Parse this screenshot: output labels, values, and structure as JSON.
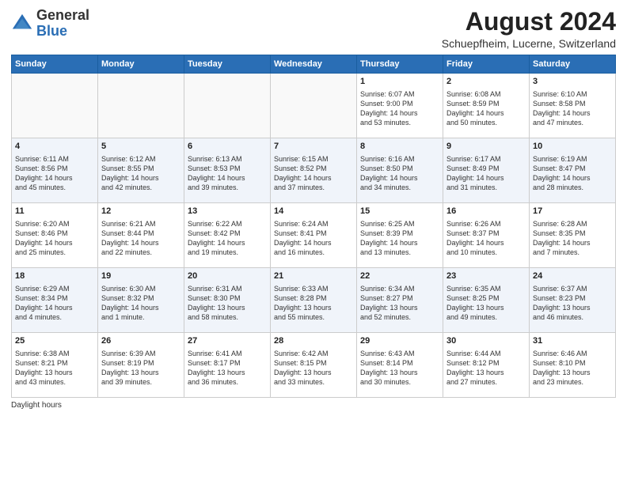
{
  "header": {
    "logo_general": "General",
    "logo_blue": "Blue",
    "month_title": "August 2024",
    "subtitle": "Schuepfheim, Lucerne, Switzerland"
  },
  "days_of_week": [
    "Sunday",
    "Monday",
    "Tuesday",
    "Wednesday",
    "Thursday",
    "Friday",
    "Saturday"
  ],
  "legend": "Daylight hours",
  "weeks": [
    [
      {
        "day": "",
        "info": ""
      },
      {
        "day": "",
        "info": ""
      },
      {
        "day": "",
        "info": ""
      },
      {
        "day": "",
        "info": ""
      },
      {
        "day": "1",
        "info": "Sunrise: 6:07 AM\nSunset: 9:00 PM\nDaylight: 14 hours\nand 53 minutes."
      },
      {
        "day": "2",
        "info": "Sunrise: 6:08 AM\nSunset: 8:59 PM\nDaylight: 14 hours\nand 50 minutes."
      },
      {
        "day": "3",
        "info": "Sunrise: 6:10 AM\nSunset: 8:58 PM\nDaylight: 14 hours\nand 47 minutes."
      }
    ],
    [
      {
        "day": "4",
        "info": "Sunrise: 6:11 AM\nSunset: 8:56 PM\nDaylight: 14 hours\nand 45 minutes."
      },
      {
        "day": "5",
        "info": "Sunrise: 6:12 AM\nSunset: 8:55 PM\nDaylight: 14 hours\nand 42 minutes."
      },
      {
        "day": "6",
        "info": "Sunrise: 6:13 AM\nSunset: 8:53 PM\nDaylight: 14 hours\nand 39 minutes."
      },
      {
        "day": "7",
        "info": "Sunrise: 6:15 AM\nSunset: 8:52 PM\nDaylight: 14 hours\nand 37 minutes."
      },
      {
        "day": "8",
        "info": "Sunrise: 6:16 AM\nSunset: 8:50 PM\nDaylight: 14 hours\nand 34 minutes."
      },
      {
        "day": "9",
        "info": "Sunrise: 6:17 AM\nSunset: 8:49 PM\nDaylight: 14 hours\nand 31 minutes."
      },
      {
        "day": "10",
        "info": "Sunrise: 6:19 AM\nSunset: 8:47 PM\nDaylight: 14 hours\nand 28 minutes."
      }
    ],
    [
      {
        "day": "11",
        "info": "Sunrise: 6:20 AM\nSunset: 8:46 PM\nDaylight: 14 hours\nand 25 minutes."
      },
      {
        "day": "12",
        "info": "Sunrise: 6:21 AM\nSunset: 8:44 PM\nDaylight: 14 hours\nand 22 minutes."
      },
      {
        "day": "13",
        "info": "Sunrise: 6:22 AM\nSunset: 8:42 PM\nDaylight: 14 hours\nand 19 minutes."
      },
      {
        "day": "14",
        "info": "Sunrise: 6:24 AM\nSunset: 8:41 PM\nDaylight: 14 hours\nand 16 minutes."
      },
      {
        "day": "15",
        "info": "Sunrise: 6:25 AM\nSunset: 8:39 PM\nDaylight: 14 hours\nand 13 minutes."
      },
      {
        "day": "16",
        "info": "Sunrise: 6:26 AM\nSunset: 8:37 PM\nDaylight: 14 hours\nand 10 minutes."
      },
      {
        "day": "17",
        "info": "Sunrise: 6:28 AM\nSunset: 8:35 PM\nDaylight: 14 hours\nand 7 minutes."
      }
    ],
    [
      {
        "day": "18",
        "info": "Sunrise: 6:29 AM\nSunset: 8:34 PM\nDaylight: 14 hours\nand 4 minutes."
      },
      {
        "day": "19",
        "info": "Sunrise: 6:30 AM\nSunset: 8:32 PM\nDaylight: 14 hours\nand 1 minute."
      },
      {
        "day": "20",
        "info": "Sunrise: 6:31 AM\nSunset: 8:30 PM\nDaylight: 13 hours\nand 58 minutes."
      },
      {
        "day": "21",
        "info": "Sunrise: 6:33 AM\nSunset: 8:28 PM\nDaylight: 13 hours\nand 55 minutes."
      },
      {
        "day": "22",
        "info": "Sunrise: 6:34 AM\nSunset: 8:27 PM\nDaylight: 13 hours\nand 52 minutes."
      },
      {
        "day": "23",
        "info": "Sunrise: 6:35 AM\nSunset: 8:25 PM\nDaylight: 13 hours\nand 49 minutes."
      },
      {
        "day": "24",
        "info": "Sunrise: 6:37 AM\nSunset: 8:23 PM\nDaylight: 13 hours\nand 46 minutes."
      }
    ],
    [
      {
        "day": "25",
        "info": "Sunrise: 6:38 AM\nSunset: 8:21 PM\nDaylight: 13 hours\nand 43 minutes."
      },
      {
        "day": "26",
        "info": "Sunrise: 6:39 AM\nSunset: 8:19 PM\nDaylight: 13 hours\nand 39 minutes."
      },
      {
        "day": "27",
        "info": "Sunrise: 6:41 AM\nSunset: 8:17 PM\nDaylight: 13 hours\nand 36 minutes."
      },
      {
        "day": "28",
        "info": "Sunrise: 6:42 AM\nSunset: 8:15 PM\nDaylight: 13 hours\nand 33 minutes."
      },
      {
        "day": "29",
        "info": "Sunrise: 6:43 AM\nSunset: 8:14 PM\nDaylight: 13 hours\nand 30 minutes."
      },
      {
        "day": "30",
        "info": "Sunrise: 6:44 AM\nSunset: 8:12 PM\nDaylight: 13 hours\nand 27 minutes."
      },
      {
        "day": "31",
        "info": "Sunrise: 6:46 AM\nSunset: 8:10 PM\nDaylight: 13 hours\nand 23 minutes."
      }
    ]
  ]
}
